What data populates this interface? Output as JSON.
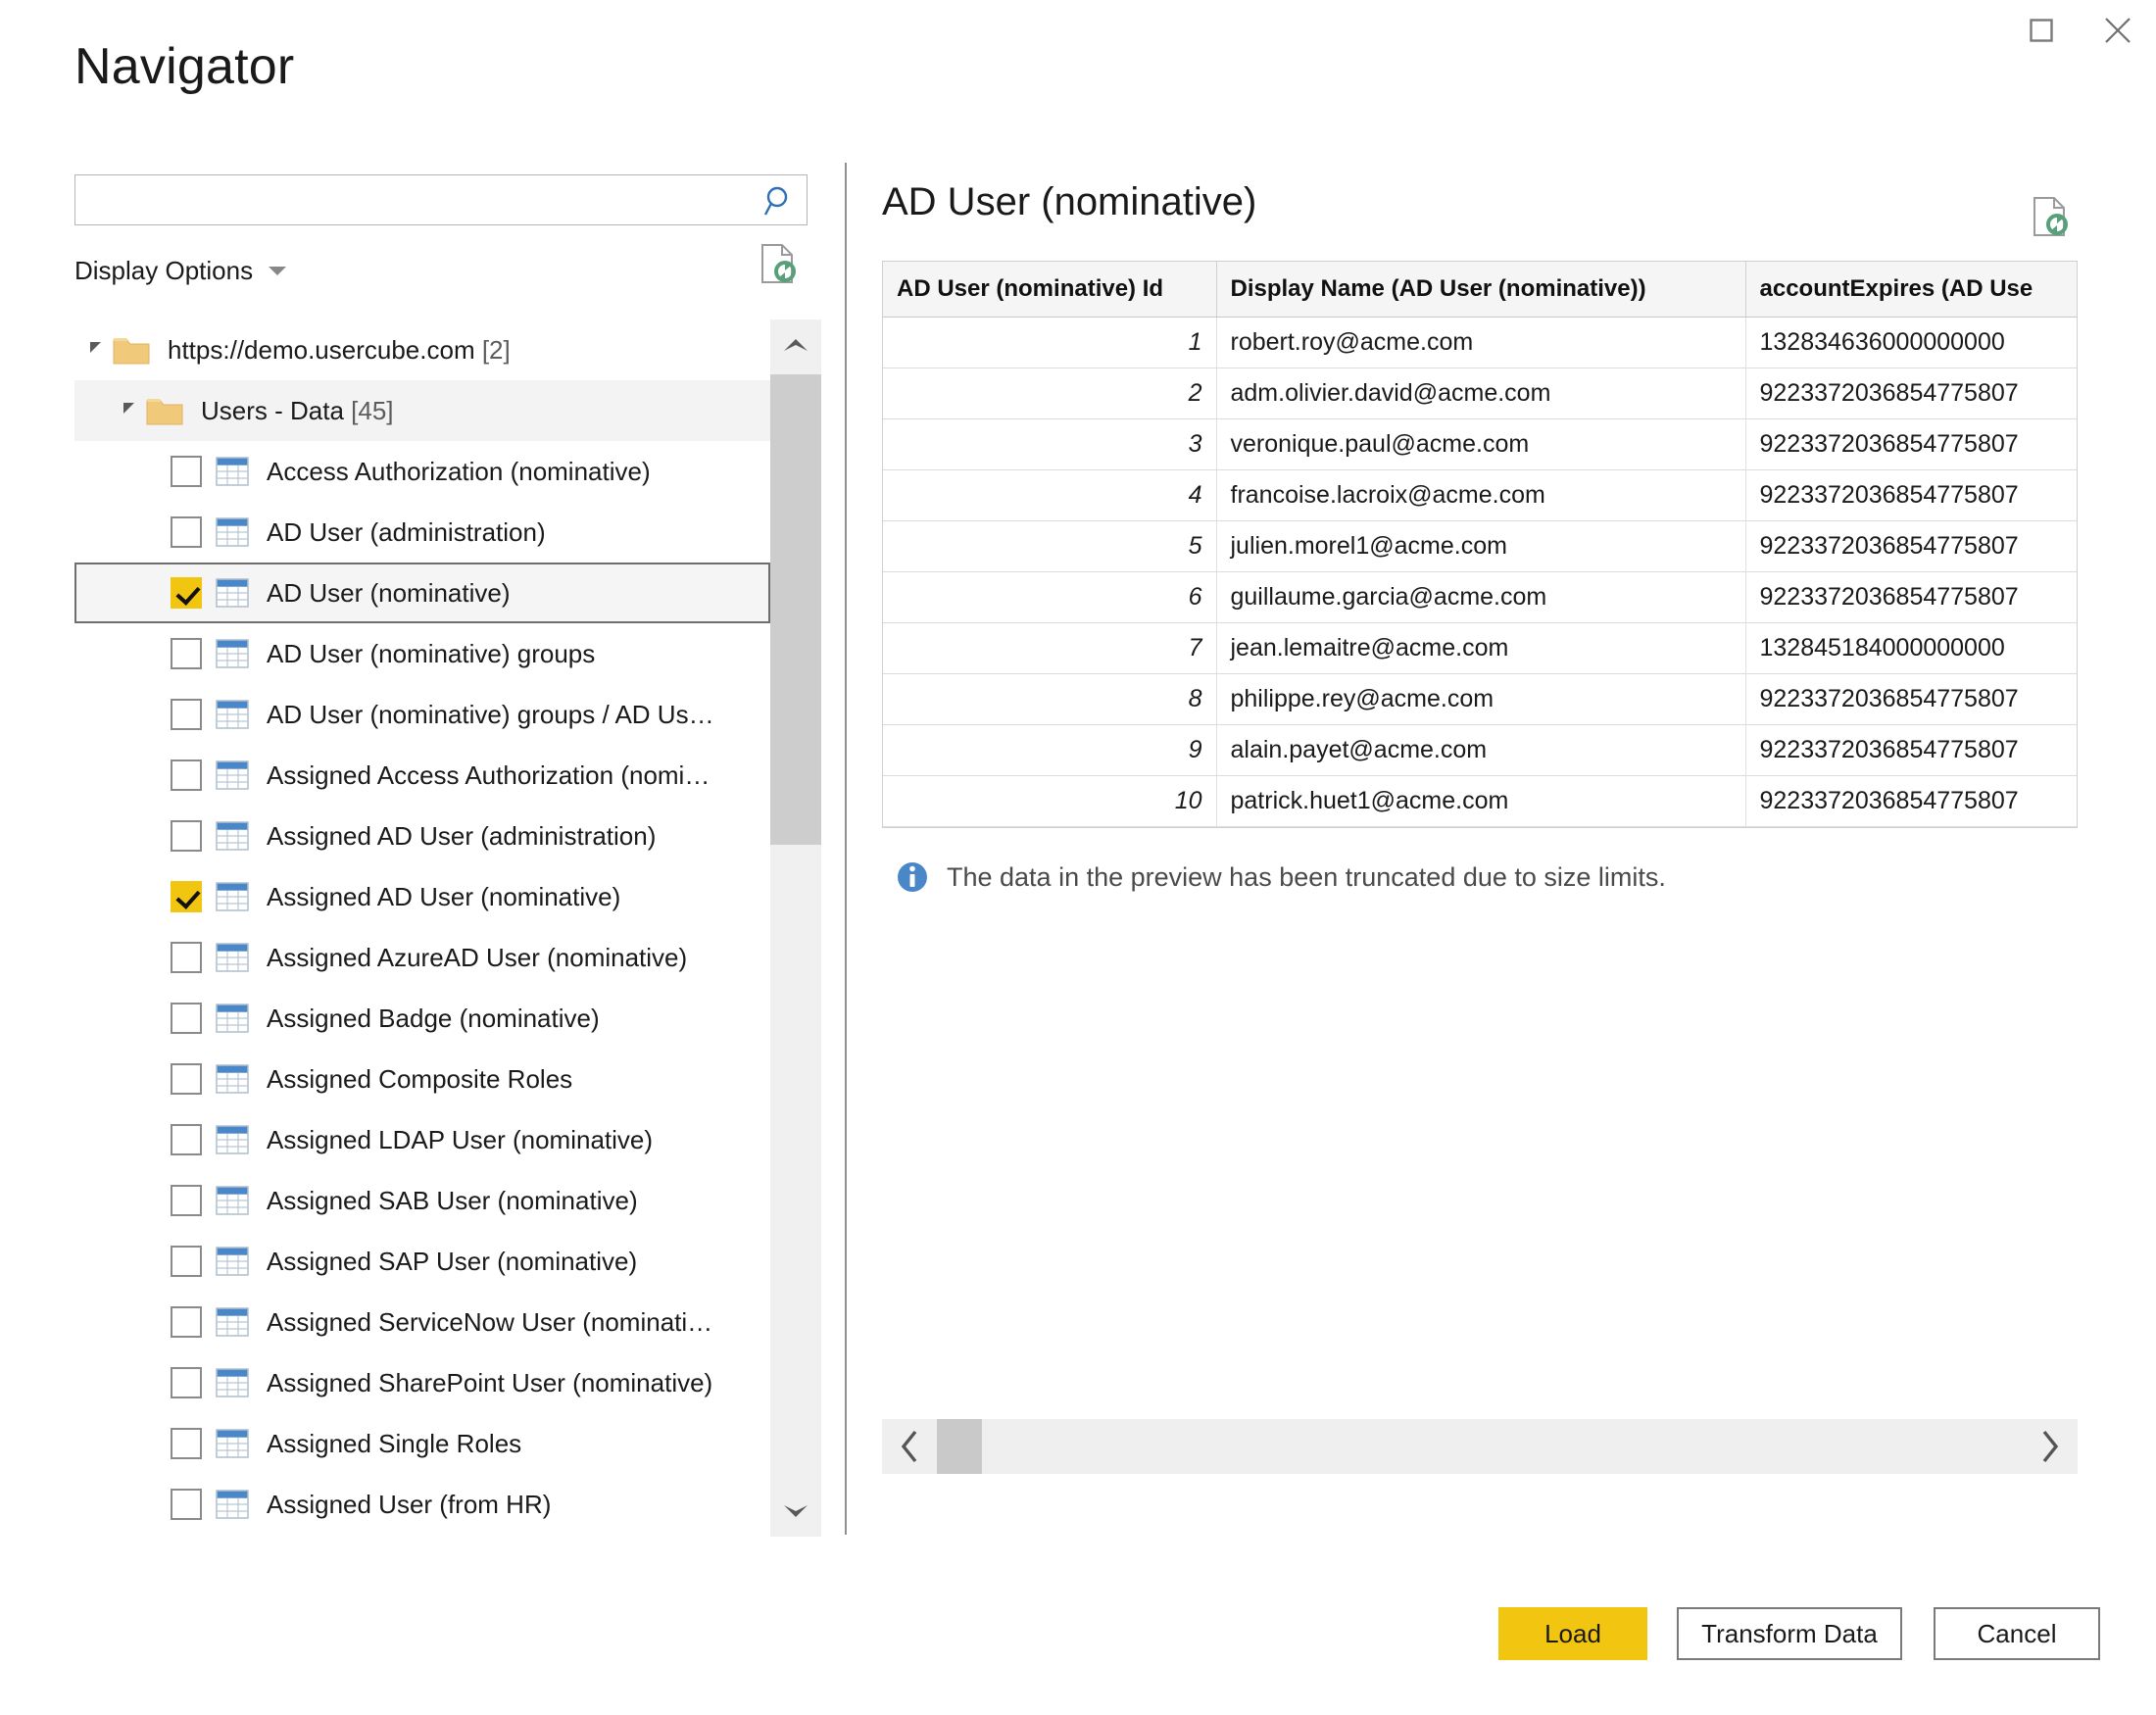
{
  "window": {
    "title": "Navigator",
    "maximize_icon": "maximize-icon",
    "close_icon": "close-icon"
  },
  "left": {
    "search": {
      "value": "",
      "placeholder": "",
      "icon": "search-icon"
    },
    "display_options_label": "Display Options",
    "refresh_icon": "refresh-document-icon",
    "tree": [
      {
        "label": "https://demo.usercube.com",
        "count": "[2]",
        "type": "root",
        "indent": 0,
        "expanded": true,
        "checkbox": null
      },
      {
        "label": "Users - Data",
        "count": "[45]",
        "type": "group",
        "indent": 1,
        "expanded": true,
        "checkbox": null
      },
      {
        "label": "Access Authorization (nominative)",
        "count": "",
        "type": "item",
        "indent": 2,
        "checkbox": "unchecked",
        "selected": false
      },
      {
        "label": "AD User (administration)",
        "count": "",
        "type": "item",
        "indent": 2,
        "checkbox": "unchecked",
        "selected": false
      },
      {
        "label": "AD User (nominative)",
        "count": "",
        "type": "item",
        "indent": 2,
        "checkbox": "checked",
        "selected": true
      },
      {
        "label": "AD User (nominative) groups",
        "count": "",
        "type": "item",
        "indent": 2,
        "checkbox": "unchecked",
        "selected": false
      },
      {
        "label": "AD User (nominative) groups / AD Us…",
        "count": "",
        "type": "item",
        "indent": 2,
        "checkbox": "unchecked",
        "selected": false
      },
      {
        "label": "Assigned Access Authorization (nomi…",
        "count": "",
        "type": "item",
        "indent": 2,
        "checkbox": "unchecked",
        "selected": false
      },
      {
        "label": "Assigned AD User (administration)",
        "count": "",
        "type": "item",
        "indent": 2,
        "checkbox": "unchecked",
        "selected": false
      },
      {
        "label": "Assigned AD User (nominative)",
        "count": "",
        "type": "item",
        "indent": 2,
        "checkbox": "checked",
        "selected": false
      },
      {
        "label": "Assigned AzureAD User (nominative)",
        "count": "",
        "type": "item",
        "indent": 2,
        "checkbox": "unchecked",
        "selected": false
      },
      {
        "label": "Assigned Badge (nominative)",
        "count": "",
        "type": "item",
        "indent": 2,
        "checkbox": "unchecked",
        "selected": false
      },
      {
        "label": "Assigned Composite Roles",
        "count": "",
        "type": "item",
        "indent": 2,
        "checkbox": "unchecked",
        "selected": false
      },
      {
        "label": "Assigned LDAP User (nominative)",
        "count": "",
        "type": "item",
        "indent": 2,
        "checkbox": "unchecked",
        "selected": false
      },
      {
        "label": "Assigned SAB User (nominative)",
        "count": "",
        "type": "item",
        "indent": 2,
        "checkbox": "unchecked",
        "selected": false
      },
      {
        "label": "Assigned SAP User (nominative)",
        "count": "",
        "type": "item",
        "indent": 2,
        "checkbox": "unchecked",
        "selected": false
      },
      {
        "label": "Assigned ServiceNow User (nominati…",
        "count": "",
        "type": "item",
        "indent": 2,
        "checkbox": "unchecked",
        "selected": false
      },
      {
        "label": "Assigned SharePoint User (nominative)",
        "count": "",
        "type": "item",
        "indent": 2,
        "checkbox": "unchecked",
        "selected": false
      },
      {
        "label": "Assigned Single Roles",
        "count": "",
        "type": "item",
        "indent": 2,
        "checkbox": "unchecked",
        "selected": false
      },
      {
        "label": "Assigned User (from HR)",
        "count": "",
        "type": "item",
        "indent": 2,
        "checkbox": "unchecked",
        "selected": false
      }
    ],
    "scrollbar": {
      "up_icon": "chevron-up-icon",
      "down_icon": "chevron-down-icon"
    }
  },
  "right": {
    "preview_title": "AD User (nominative)",
    "refresh_icon": "refresh-document-icon",
    "table": {
      "columns": [
        "AD User (nominative) Id",
        "Display Name (AD User (nominative))",
        "accountExpires (AD Use"
      ],
      "rows": [
        [
          "1",
          "robert.roy@acme.com",
          "132834636000000000"
        ],
        [
          "2",
          "adm.olivier.david@acme.com",
          "9223372036854775807"
        ],
        [
          "3",
          "veronique.paul@acme.com",
          "9223372036854775807"
        ],
        [
          "4",
          "francoise.lacroix@acme.com",
          "9223372036854775807"
        ],
        [
          "5",
          "julien.morel1@acme.com",
          "9223372036854775807"
        ],
        [
          "6",
          "guillaume.garcia@acme.com",
          "9223372036854775807"
        ],
        [
          "7",
          "jean.lemaitre@acme.com",
          "132845184000000000"
        ],
        [
          "8",
          "philippe.rey@acme.com",
          "9223372036854775807"
        ],
        [
          "9",
          "alain.payet@acme.com",
          "9223372036854775807"
        ],
        [
          "10",
          "patrick.huet1@acme.com",
          "9223372036854775807"
        ]
      ]
    },
    "info_message": "The data in the preview has been truncated due to size limits.",
    "info_icon": "info-icon",
    "scrollbar": {
      "left_icon": "chevron-left-icon",
      "right_icon": "chevron-right-icon"
    }
  },
  "footer": {
    "load_label": "Load",
    "transform_label": "Transform Data",
    "cancel_label": "Cancel"
  },
  "colors": {
    "accent_yellow": "#f2c511",
    "table_header_blue": "#4a87c8",
    "folder_tan": "#efc濃"
  }
}
